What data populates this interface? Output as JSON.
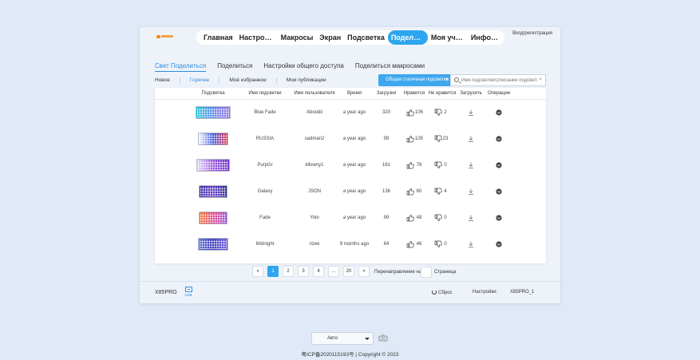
{
  "nav": {
    "items": [
      {
        "label": "Главная",
        "active": false
      },
      {
        "label": "Настрой...",
        "active": false
      },
      {
        "label": "Макросы",
        "active": false
      },
      {
        "label": "Экран",
        "active": false
      },
      {
        "label": "Подсветка",
        "active": false
      },
      {
        "label": "Поделит...",
        "active": true
      },
      {
        "label": "Моя учет...",
        "active": false
      },
      {
        "label": "Информ...",
        "active": false
      }
    ],
    "login": "Вход/регистрация"
  },
  "subtabs": [
    {
      "label": "Свет Поделиться",
      "active": true
    },
    {
      "label": "Поделиться",
      "active": false
    },
    {
      "label": "Настройки общего доступа",
      "active": false
    },
    {
      "label": "Поделиться макросами",
      "active": false
    }
  ],
  "filters": [
    {
      "label": "Новое",
      "active": false
    },
    {
      "label": "Горячее",
      "active": true
    },
    {
      "label": "Моё избранное",
      "active": false
    },
    {
      "label": "Мои публикации",
      "active": false
    }
  ],
  "dropdown": {
    "label": "Общая статичная подсветка",
    "caret": "▾"
  },
  "search": {
    "placeholder": "Имя подсветки/Описание подсветки",
    "clear": "×"
  },
  "table": {
    "headers": [
      "Подсветка",
      "Имя подсветки",
      "Имя пользователя",
      "Время",
      "Загрузки",
      "Нравится",
      "Не нравится",
      "Загрузить",
      "Операции"
    ],
    "rows": [
      {
        "name": "Blue Fade",
        "user": "Aboodii",
        "time": "a year ago",
        "downloads": "320",
        "likes": "106",
        "dislikes": "2",
        "colors": [
          "#19c6d6",
          "#5f86ea",
          "#9b6fe6"
        ]
      },
      {
        "name": "RUSSIA",
        "user": "sadman2",
        "time": "a year ago",
        "downloads": "99",
        "likes": "105",
        "dislikes": "23",
        "colors": [
          "#f3f5fb",
          "#3f57e0",
          "#e43a4a"
        ]
      },
      {
        "name": "PurpGr",
        "user": "kllowny1",
        "time": "a year ago",
        "downloads": "161",
        "likes": "78",
        "dislikes": "0",
        "colors": [
          "#e1d9f6",
          "#9b56e2",
          "#6c34c4"
        ]
      },
      {
        "name": "Galaxy",
        "user": "JSON",
        "time": "a year ago",
        "downloads": "136",
        "likes": "60",
        "dislikes": "4",
        "colors": [
          "#3c2f9c",
          "#6a3fcf",
          "#2a2f8a"
        ]
      },
      {
        "name": "Fade",
        "user": "Yolo",
        "time": "a year ago",
        "downloads": "99",
        "likes": "48",
        "dislikes": "0",
        "colors": [
          "#f07a2a",
          "#e34a8a",
          "#9b4fe0"
        ]
      },
      {
        "name": "Midnight",
        "user": "rizee",
        "time": "9 months ago",
        "downloads": "64",
        "likes": "46",
        "dislikes": "0",
        "colors": [
          "#5868d8",
          "#3f3ab8",
          "#6a58d8"
        ]
      }
    ]
  },
  "pagination": {
    "prev": "«",
    "pages": [
      {
        "label": "1",
        "active": true
      },
      {
        "label": "2",
        "active": false
      },
      {
        "label": "3",
        "active": false
      },
      {
        "label": "4",
        "active": false
      },
      {
        "label": "...",
        "active": false
      },
      {
        "label": "20",
        "active": false
      }
    ],
    "next": "»",
    "goto_label": "Перенаправление на",
    "goto_suffix": "Страница"
  },
  "device": {
    "name": "X85PRO",
    "connection": "USB",
    "reset": "Сброс",
    "settings_label": "Настройки:",
    "settings_value": "X85PRO_1"
  },
  "mode": {
    "value": "Авто"
  },
  "footer": {
    "text": "粤ICP备2020115193号 | Copyright © 2023"
  },
  "colors": {
    "accent": "#2ea6ee",
    "background": "#dfe9f7"
  },
  "icons": [
    "thumb-up-icon",
    "thumb-down-icon",
    "download-icon",
    "operation-menu-icon",
    "search-icon",
    "clear-icon",
    "reset-icon",
    "usb-icon",
    "keyboard-icon"
  ]
}
